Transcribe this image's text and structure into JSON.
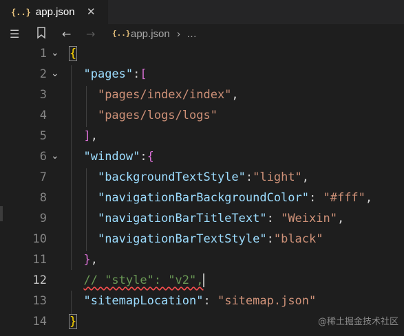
{
  "tab": {
    "icon_text": "{..}",
    "filename": "app.json",
    "close_glyph": "✕"
  },
  "breadcrumb": {
    "icon_text": "{..}",
    "file": "app.json",
    "separator": "›",
    "more": "…"
  },
  "editor": {
    "active_line": 12,
    "lines": [
      {
        "num": "1"
      },
      {
        "num": "2",
        "key": "\"pages\""
      },
      {
        "num": "3",
        "value": "\"pages/index/index\""
      },
      {
        "num": "4",
        "value": "\"pages/logs/logs\""
      },
      {
        "num": "5"
      },
      {
        "num": "6",
        "key": "\"window\""
      },
      {
        "num": "7",
        "key": "\"backgroundTextStyle\"",
        "value": "\"light\""
      },
      {
        "num": "8",
        "key": "\"navigationBarBackgroundColor\"",
        "value": "\"#fff\""
      },
      {
        "num": "9",
        "key": "\"navigationBarTitleText\"",
        "value": "\"Weixin\""
      },
      {
        "num": "10",
        "key": "\"navigationBarTextStyle\"",
        "value": "\"black\""
      },
      {
        "num": "11"
      },
      {
        "num": "12",
        "comment": "// \"style\": \"v2\","
      },
      {
        "num": "13",
        "key": "\"sitemapLocation\"",
        "value": "\"sitemap.json\""
      },
      {
        "num": "14"
      }
    ]
  },
  "watermark": "@稀土掘金技术社区",
  "colors": {
    "background": "#1e1e1e",
    "key": "#9cdcfe",
    "string": "#ce9178",
    "comment": "#6a9955",
    "bracket_level1": "#ffd700",
    "bracket_level2": "#da70d6",
    "bracket_level3": "#179fff"
  }
}
